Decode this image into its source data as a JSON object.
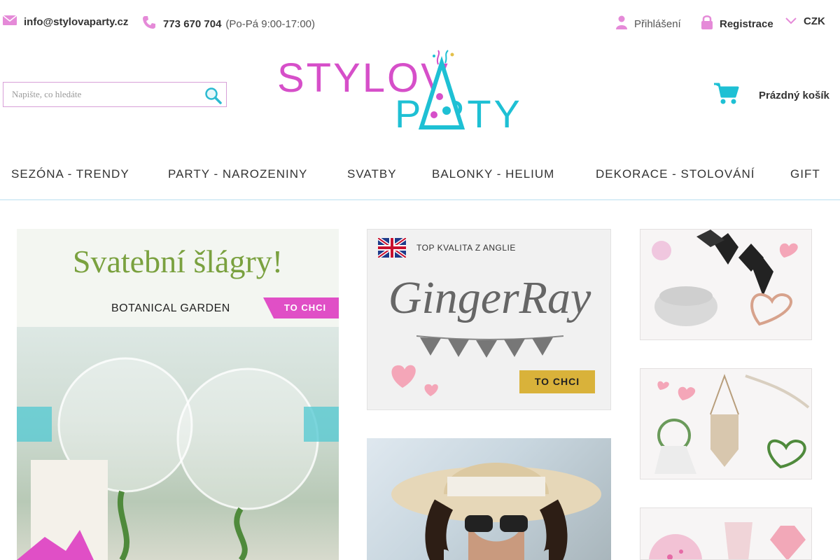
{
  "topbar": {
    "email": "info@stylovaparty.cz",
    "phone": "773 670 704",
    "hours": "(Po-Pá 9:00-17:00)",
    "login": "Přihlášení",
    "register": "Registrace",
    "currency": "CZK"
  },
  "search": {
    "placeholder": "Napište, co hledáte"
  },
  "logo": {
    "line1": "STYLOV",
    "line2": "P RTY"
  },
  "cart": {
    "label": "Prázdný košík"
  },
  "nav": {
    "items": [
      "SEZÓNA - TRENDY",
      "PARTY - NAROZENINY",
      "SVATBY",
      "BALONKY - HELIUM",
      "DEKORACE - STOLOVÁNÍ",
      "GIFT"
    ]
  },
  "banners": {
    "main": {
      "title": "Svatební šlágry!",
      "subtitle": "BOTANICAL GARDEN",
      "cta": "TO CHCI",
      "prev": "",
      "next": ""
    },
    "ginger": {
      "tag": "TOP KVALITA Z ANGLIE",
      "brand": "GingerRay",
      "cta": "TO CHCI"
    }
  },
  "colors": {
    "brand_pink": "#d64fc9",
    "brand_cyan": "#1ec0d4",
    "cta_pink": "#e04fc6",
    "cta_gold": "#d9b23a",
    "title_green": "#7aa13f"
  }
}
